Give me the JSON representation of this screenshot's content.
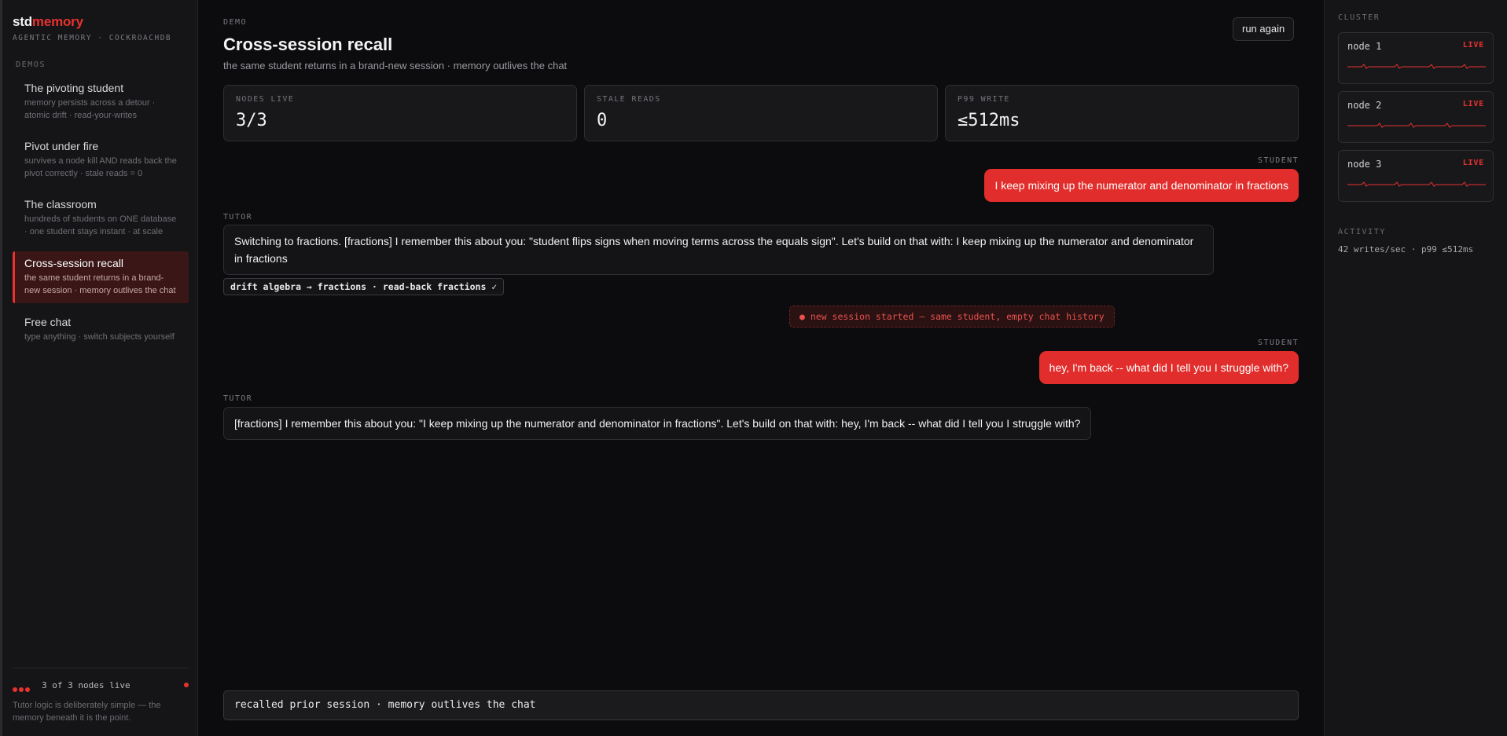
{
  "brand": {
    "part1": "std",
    "part2": "memory",
    "subtitle": "AGENTIC MEMORY · COCKROACHDB"
  },
  "sidebar": {
    "section_label": "DEMOS",
    "items": [
      {
        "title": "The pivoting student",
        "desc": "memory persists across a detour · atomic drift · read-your-writes"
      },
      {
        "title": "Pivot under fire",
        "desc": "survives a node kill AND reads back the pivot correctly · stale reads = 0"
      },
      {
        "title": "The classroom",
        "desc": "hundreds of students on ONE database · one student stays instant · at scale"
      },
      {
        "title": "Cross-session recall",
        "desc": "the same student returns in a brand-new session · memory outlives the chat"
      },
      {
        "title": "Free chat",
        "desc": "type anything · switch subjects yourself"
      }
    ],
    "nodes_live": "3 of 3 nodes live",
    "footer": "Tutor logic is deliberately simple — the memory beneath it is the point."
  },
  "main": {
    "eyebrow": "DEMO",
    "title": "Cross-session recall",
    "subtitle": "the same student returns in a brand-new session · memory outlives the chat",
    "run_again": "run again",
    "stats": [
      {
        "label": "NODES LIVE",
        "value": "3/3"
      },
      {
        "label": "STALE READS",
        "value": "0"
      },
      {
        "label": "P99 WRITE",
        "value": "≤512ms"
      }
    ],
    "messages": {
      "student_label": "STUDENT",
      "tutor_label": "TUTOR",
      "student_1": "I keep mixing up the numerator and denominator in fractions",
      "tutor_1": "Switching to fractions. [fractions] I remember this about you: \"student flips signs when moving terms across the equals sign\". Let's build on that with: I keep mixing up the numerator and denominator in fractions",
      "drift_chip": "drift algebra → fractions · read-back fractions ✓",
      "session_notice": "● new session started — same student, empty chat history",
      "student_2": "hey, I'm back -- what did I tell you I struggle with?",
      "tutor_2": "[fractions] I remember this about you: \"I keep mixing up the numerator and denominator in fractions\". Let's build on that with: hey, I'm back -- what did I tell you I struggle with?"
    },
    "status_bar": "recalled prior session · memory outlives the chat"
  },
  "cluster": {
    "label": "CLUSTER",
    "nodes": [
      {
        "name": "node 1",
        "status": "LIVE"
      },
      {
        "name": "node 2",
        "status": "LIVE"
      },
      {
        "name": "node 3",
        "status": "LIVE"
      }
    ],
    "activity_label": "ACTIVITY",
    "activity": "42 writes/sec · p99 ≤512ms"
  },
  "colors": {
    "accent": "#e8322f",
    "bg": "#0c0c0e",
    "panel": "#151517"
  }
}
